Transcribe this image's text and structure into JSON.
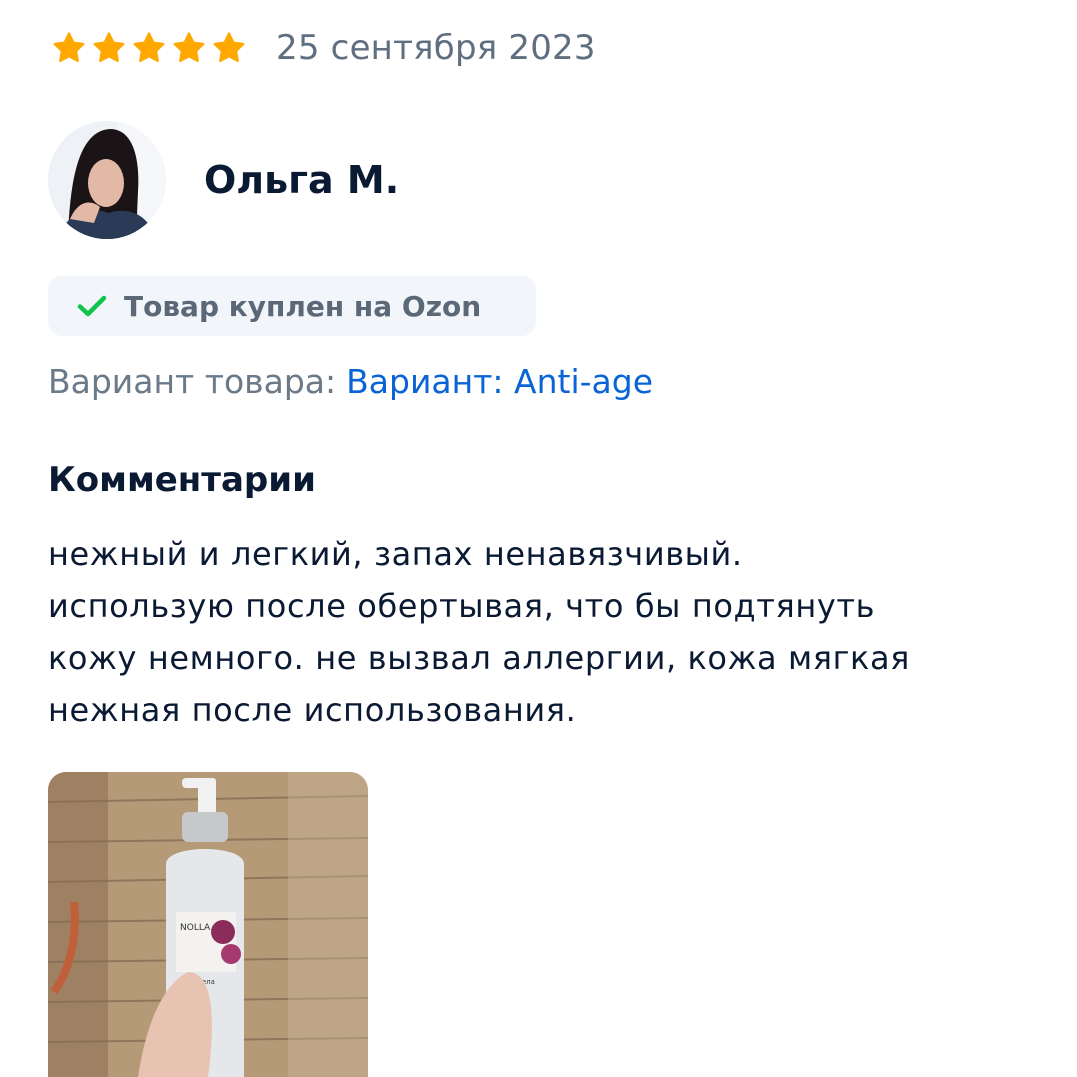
{
  "review": {
    "rating": 5,
    "rating_max": 5,
    "date": "25 сентября 2023",
    "author": {
      "name": "Ольга М."
    },
    "purchased_badge": "Товар куплен на Ozon",
    "variant": {
      "label": "Вариант товара:",
      "value": "Вариант: Anti-age"
    },
    "comments_heading": "Комментарии",
    "comment_lines": [
      "нежный и легкий, запах ненавязчивый.",
      "использую после обертывая, что бы подтянуть",
      "кожу немного. не вызвал аллергии, кожа мягкая",
      "нежная после использования."
    ],
    "photo": {
      "product_brand": "NOLLA",
      "product_line": "для тела"
    }
  },
  "colors": {
    "star": "#ffa800",
    "check": "#10c44c",
    "link": "#0a64d6",
    "badge_bg": "#f2f5f9"
  }
}
